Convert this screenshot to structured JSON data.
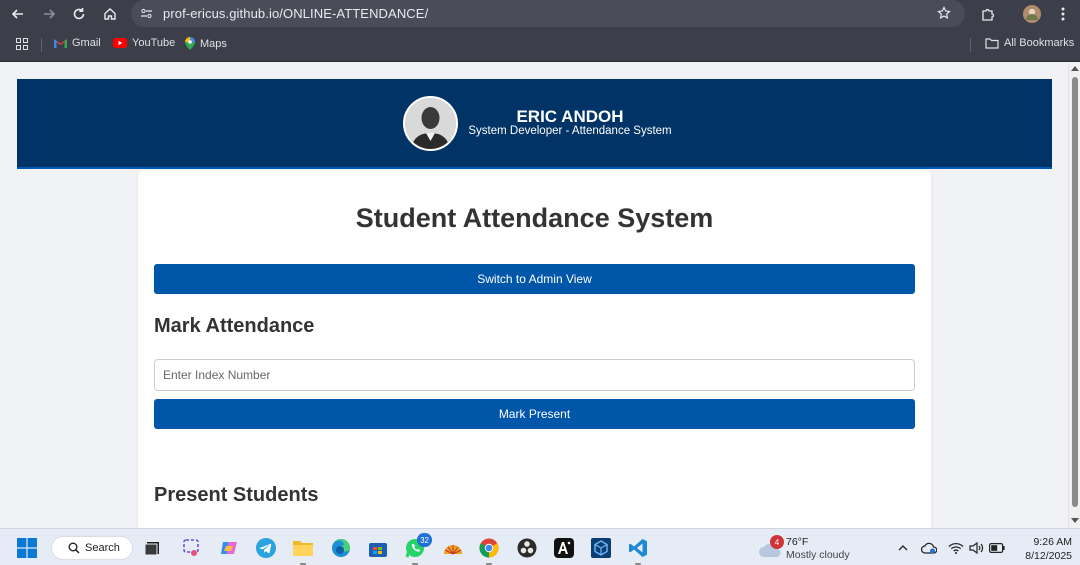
{
  "browser": {
    "url": "prof-ericus.github.io/ONLINE-ATTENDANCE/",
    "bookmarks": [
      {
        "label": "Gmail",
        "icon": "gmail-icon"
      },
      {
        "label": "YouTube",
        "icon": "youtube-icon"
      },
      {
        "label": "Maps",
        "icon": "maps-icon"
      }
    ],
    "all_bookmarks_label": "All Bookmarks"
  },
  "header": {
    "name": "ERIC ANDOH",
    "role": "System Developer - Attendance System"
  },
  "main": {
    "title": "Student Attendance System",
    "switch_button": "Switch to Admin View",
    "mark_section_title": "Mark Attendance",
    "index_placeholder": "Enter Index Number",
    "mark_button": "Mark Present",
    "present_section_title": "Present Students"
  },
  "taskbar": {
    "search_label": "Search",
    "whatsapp_badge": "32",
    "weather_badge": "4",
    "weather_temp": "76°F",
    "weather_desc": "Mostly cloudy",
    "time": "9:26 AM",
    "date": "8/12/2025"
  },
  "colors": {
    "header_bg": "#003366",
    "button_bg": "#0056a8",
    "chrome_bg": "#3c3f4a"
  }
}
